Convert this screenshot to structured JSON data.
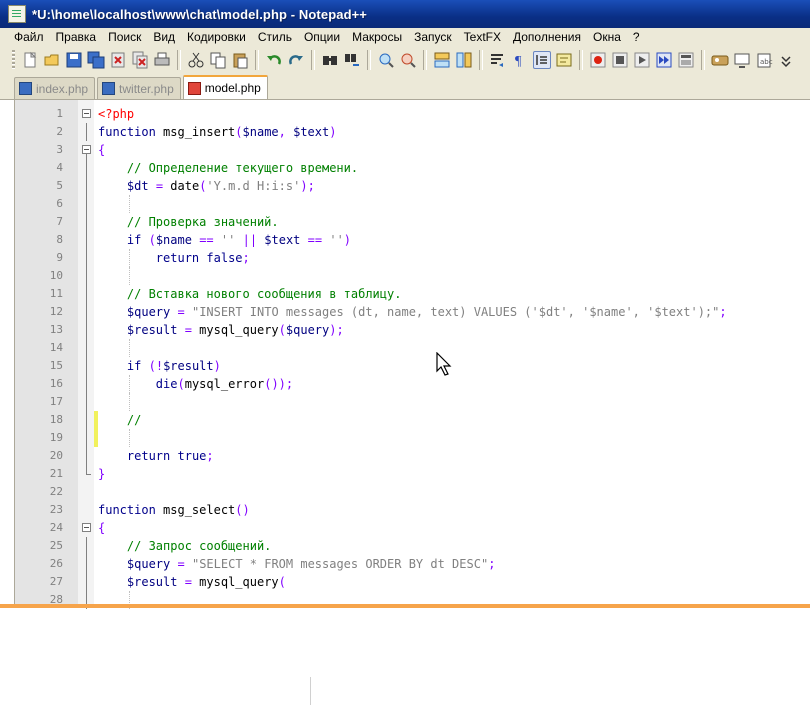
{
  "window": {
    "title": "*U:\\home\\localhost\\www\\chat\\model.php - Notepad++"
  },
  "menu": [
    "Файл",
    "Правка",
    "Поиск",
    "Вид",
    "Кодировки",
    "Стиль",
    "Опции",
    "Макросы",
    "Запуск",
    "TextFX",
    "Дополнения",
    "Окна",
    "?"
  ],
  "toolbar": {
    "icons": [
      "new-file-icon",
      "open-file-icon",
      "save-icon",
      "save-all-icon",
      "close-icon",
      "close-all-icon",
      "print-icon",
      "cut-icon",
      "copy-icon",
      "paste-icon",
      "undo-icon",
      "redo-icon",
      "find-icon",
      "replace-icon",
      "zoom-in-icon",
      "zoom-out-icon",
      "sync-v-icon",
      "sync-h-icon",
      "wrap-icon",
      "show-all-chars-icon",
      "indent-guide-icon",
      "user-lang-icon",
      "record-macro-icon",
      "stop-macro-icon",
      "play-macro-icon",
      "run-macro-multiple-icon",
      "save-macro-icon",
      "spell-check-icon",
      "screen-icon",
      "clipboard-icon",
      "more-icon"
    ]
  },
  "tabs": [
    {
      "label": "index.php",
      "active": false
    },
    {
      "label": "twitter.php",
      "active": false
    },
    {
      "label": "model.php",
      "active": true
    }
  ],
  "editor": {
    "lines": [
      {
        "n": "1",
        "text": "<?php"
      },
      {
        "n": "2",
        "text": "function msg_insert($name, $text)"
      },
      {
        "n": "3",
        "text": "{"
      },
      {
        "n": "4",
        "text": "    // Определение текущего времени."
      },
      {
        "n": "5",
        "text": "    $dt = date('Y.m.d H:i:s');"
      },
      {
        "n": "6",
        "text": ""
      },
      {
        "n": "7",
        "text": "    // Проверка значений."
      },
      {
        "n": "8",
        "text": "    if ($name == '' || $text == '')"
      },
      {
        "n": "9",
        "text": "        return false;"
      },
      {
        "n": "10",
        "text": ""
      },
      {
        "n": "11",
        "text": "    // Вставка нового сообщения в таблицу."
      },
      {
        "n": "12",
        "text": "    $query = \"INSERT INTO messages (dt, name, text) VALUES ('$dt', '$name', '$text');\";"
      },
      {
        "n": "13",
        "text": "    $result = mysql_query($query);"
      },
      {
        "n": "14",
        "text": ""
      },
      {
        "n": "15",
        "text": "    if (!$result)"
      },
      {
        "n": "16",
        "text": "        die(mysql_error());"
      },
      {
        "n": "17",
        "text": ""
      },
      {
        "n": "18",
        "text": "    //"
      },
      {
        "n": "19",
        "text": ""
      },
      {
        "n": "20",
        "text": "    return true;"
      },
      {
        "n": "21",
        "text": "}"
      },
      {
        "n": "22",
        "text": ""
      },
      {
        "n": "23",
        "text": "function msg_select()"
      },
      {
        "n": "24",
        "text": "{"
      },
      {
        "n": "25",
        "text": "    // Запрос сообщений."
      },
      {
        "n": "26",
        "text": "    $query = \"SELECT * FROM messages ORDER BY dt DESC\";"
      },
      {
        "n": "27",
        "text": "    $result = mysql_query("
      },
      {
        "n": "28",
        "text": ""
      }
    ]
  },
  "colors": {
    "keyword": "#00008b",
    "variable": "#000080",
    "comment": "#008000",
    "string": "#808080",
    "php_tag": "#ff0000",
    "operator": "#8000ff"
  }
}
